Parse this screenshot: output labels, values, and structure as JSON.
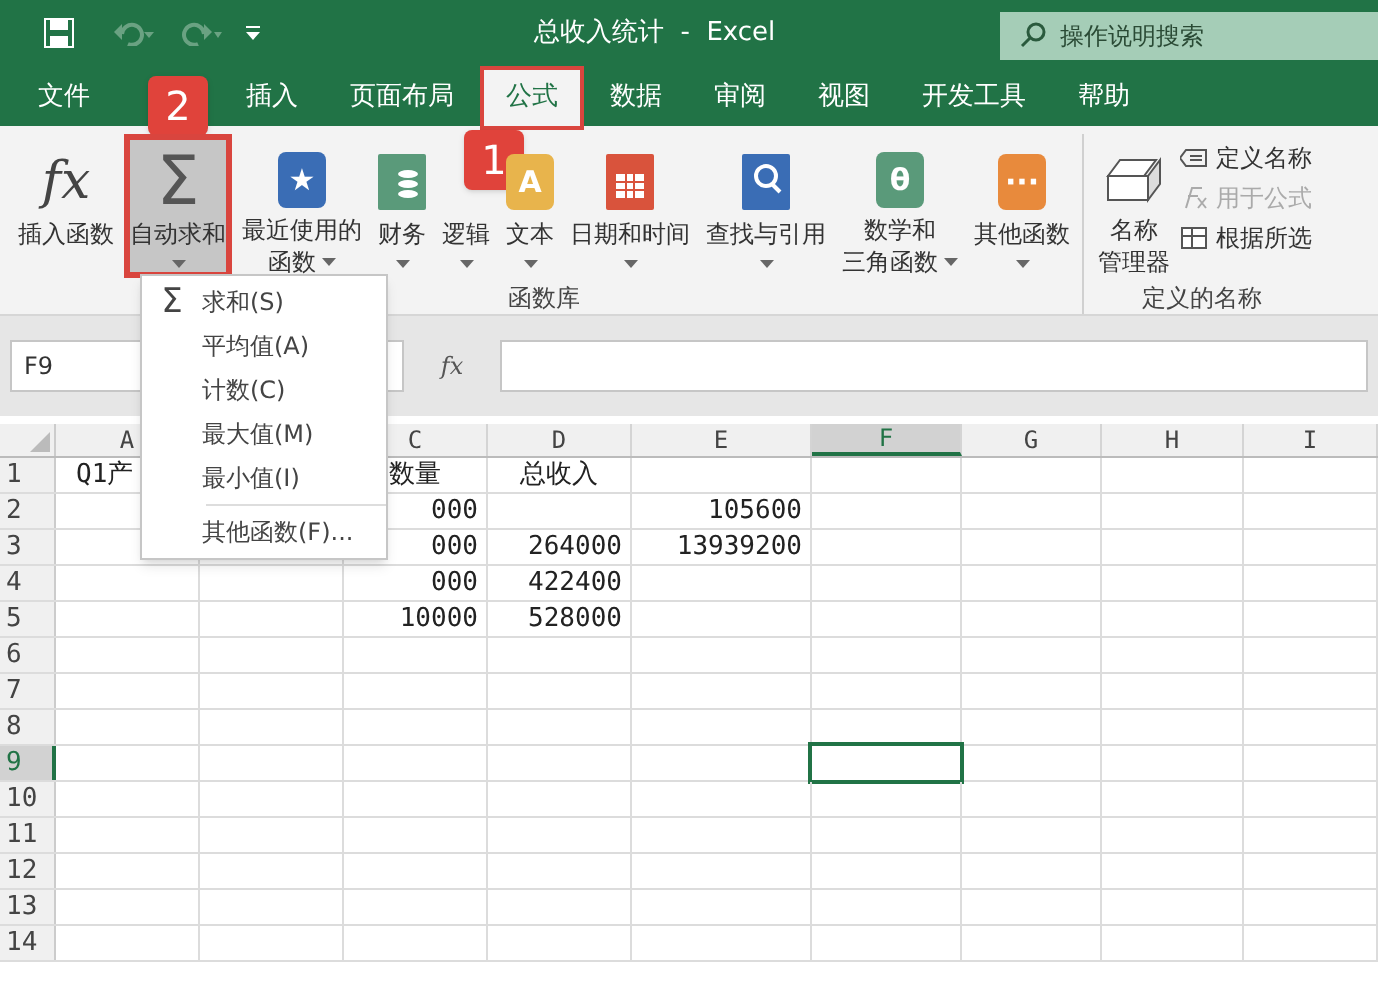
{
  "title_bar": {
    "title": "总收入统计  -  Excel",
    "search_placeholder": "操作说明搜索"
  },
  "menu_tabs": [
    {
      "label": "文件",
      "selected": false,
      "highlighted": false
    },
    {
      "covered_by_badge": "2"
    },
    {
      "label": "插入",
      "selected": false,
      "highlighted": false
    },
    {
      "label": "页面布局",
      "selected": false,
      "highlighted": false
    },
    {
      "label": "公式",
      "selected": true,
      "highlighted": true
    },
    {
      "label": "数据",
      "selected": false,
      "highlighted": false
    },
    {
      "label": "审阅",
      "selected": false,
      "highlighted": false
    },
    {
      "label": "视图",
      "selected": false,
      "highlighted": false
    },
    {
      "label": "开发工具",
      "selected": false,
      "highlighted": false
    },
    {
      "label": "帮助",
      "selected": false,
      "highlighted": false
    }
  ],
  "ribbon": {
    "groups": [
      {
        "label": "函数库",
        "buttons": [
          {
            "kind": "fx",
            "icon_text": "fx",
            "lines": [
              "插入函数"
            ],
            "caret": false,
            "highlighted": false,
            "pressed": false
          },
          {
            "kind": "sigma",
            "icon_text": "Σ",
            "lines": [
              "自动求和"
            ],
            "caret": true,
            "highlighted": true,
            "pressed": true
          },
          {
            "kind": "book",
            "color": "#3a6db5",
            "icon_text": "★",
            "lines": [
              "最近使用的",
              "函数"
            ],
            "caret": true,
            "highlighted": false,
            "pressed": false
          },
          {
            "kind": "coins",
            "color": "#5a9a7a",
            "lines": [
              "财务"
            ],
            "caret": true,
            "highlighted": false,
            "pressed": false
          },
          {
            "kind": "covered",
            "lines": [
              "逻辑"
            ],
            "caret": true,
            "highlighted": false,
            "pressed": false,
            "badge": "1"
          },
          {
            "kind": "book",
            "color": "#e8b44c",
            "icon_text": "A",
            "lines": [
              "文本"
            ],
            "caret": true,
            "highlighted": false,
            "pressed": false
          },
          {
            "kind": "calendar",
            "color": "#d9533c",
            "lines": [
              "日期和时间"
            ],
            "caret": true,
            "highlighted": false,
            "pressed": false
          },
          {
            "kind": "search",
            "color": "#3a6db5",
            "lines": [
              "查找与引用"
            ],
            "caret": true,
            "highlighted": false,
            "pressed": false
          },
          {
            "kind": "book",
            "color": "#5a9a7a",
            "icon_text": "θ",
            "lines": [
              "数学和",
              "三角函数"
            ],
            "caret": true,
            "highlighted": false,
            "pressed": false
          },
          {
            "kind": "book",
            "color": "#e88a3c",
            "icon_text": "···",
            "lines": [
              "其他函数"
            ],
            "caret": true,
            "highlighted": false,
            "pressed": false
          }
        ]
      },
      {
        "label": "定义的名称",
        "buttons": [
          {
            "kind": "names",
            "lines": [
              "名称",
              "管理器"
            ],
            "caret": false,
            "highlighted": false,
            "pressed": false
          }
        ],
        "small_items": [
          {
            "label": "定义名称",
            "disabled": false,
            "kind": "tag"
          },
          {
            "label": "用于公式",
            "disabled": true,
            "kind": "fx"
          },
          {
            "label": "根据所选",
            "disabled": false,
            "kind": "table"
          }
        ]
      }
    ]
  },
  "autosum_menu": {
    "items": [
      {
        "label": "求和(S)",
        "icon_text": "Σ",
        "separator_before": false
      },
      {
        "label": "平均值(A)",
        "separator_before": false
      },
      {
        "label": "计数(C)",
        "separator_before": false
      },
      {
        "label": "最大值(M)",
        "separator_before": false
      },
      {
        "label": "最小值(I)",
        "separator_before": false
      },
      {
        "label": "其他函数(F)...",
        "separator_before": true
      }
    ]
  },
  "formula_bar": {
    "name_box": "F9",
    "fx": "fx"
  },
  "sheet": {
    "columns": [
      {
        "label": "A",
        "selected": false
      },
      null,
      {
        "label": "C",
        "selected": false
      },
      {
        "label": "D",
        "selected": false
      },
      {
        "label": "E",
        "selected": false
      },
      {
        "label": "F",
        "selected": true
      },
      {
        "label": "G",
        "selected": false
      },
      {
        "label": "H",
        "selected": false
      },
      {
        "label": "I",
        "selected": false
      }
    ],
    "rows": [
      {
        "label": "1",
        "selected": false,
        "cells": [
          "Q1产",
          "",
          "数量",
          "总收入"
        ]
      },
      {
        "label": "2",
        "selected": false,
        "cells": [
          "",
          "",
          "000",
          "",
          "105600"
        ]
      },
      {
        "label": "3",
        "selected": false,
        "cells": [
          "",
          "",
          "000",
          "264000",
          "13939200"
        ]
      },
      {
        "label": "4",
        "selected": false,
        "cells": [
          "",
          "",
          "000",
          "422400"
        ]
      },
      {
        "label": "5",
        "selected": false,
        "cells": [
          "",
          "",
          "10000",
          "528000"
        ]
      },
      {
        "label": "6",
        "selected": false
      },
      {
        "label": "7",
        "selected": false
      },
      {
        "label": "8",
        "selected": false
      },
      {
        "label": "9",
        "selected": true
      },
      {
        "label": "10",
        "selected": false
      },
      {
        "label": "11",
        "selected": false
      },
      {
        "label": "12",
        "selected": false
      },
      {
        "label": "13",
        "selected": false
      },
      {
        "label": "14",
        "selected": false
      }
    ]
  }
}
